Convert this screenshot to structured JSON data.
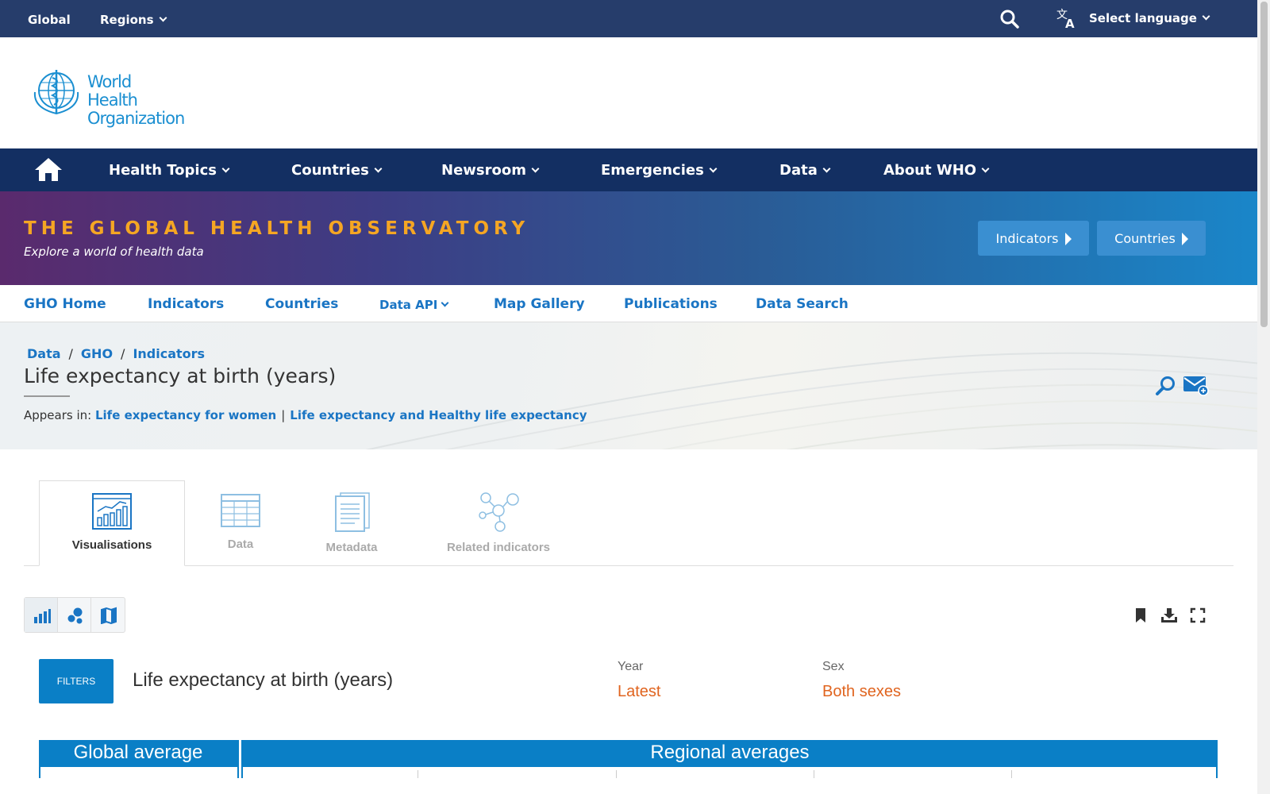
{
  "topbar": {
    "global": "Global",
    "regions": "Regions",
    "language": "Select language"
  },
  "logo": {
    "line1": "World Health",
    "line2": "Organization"
  },
  "mainnav": [
    "Health Topics",
    "Countries",
    "Newsroom",
    "Emergencies",
    "Data",
    "About WHO"
  ],
  "banner": {
    "title": "THE GLOBAL HEALTH OBSERVATORY",
    "subtitle": "Explore a world of health data",
    "btn_indicators": "Indicators",
    "btn_countries": "Countries"
  },
  "subnav": [
    "GHO Home",
    "Indicators",
    "Countries",
    "Data API",
    "Map Gallery",
    "Publications",
    "Data Search"
  ],
  "breadcrumb": [
    "Data",
    "GHO",
    "Indicators"
  ],
  "page": {
    "title": "Life expectancy at birth (years)",
    "appears_label": "Appears in:",
    "appears_1": "Life expectancy for women",
    "appears_2": "Life expectancy and Healthy life expectancy"
  },
  "tabs": [
    "Visualisations",
    "Data",
    "Metadata",
    "Related indicators"
  ],
  "filters": {
    "button": "FILTERS",
    "title": "Life expectancy at birth (years)",
    "year_label": "Year",
    "year_value": "Latest",
    "sex_label": "Sex",
    "sex_value": "Both sexes"
  },
  "table": {
    "global_header": "Global average",
    "regional_header": "Regional averages"
  },
  "colors": {
    "topbar": "#263d6b",
    "mainnav": "#132f62",
    "accent": "#0a7fc6",
    "banner_title": "#f5a623",
    "filter_value": "#e0641f"
  }
}
